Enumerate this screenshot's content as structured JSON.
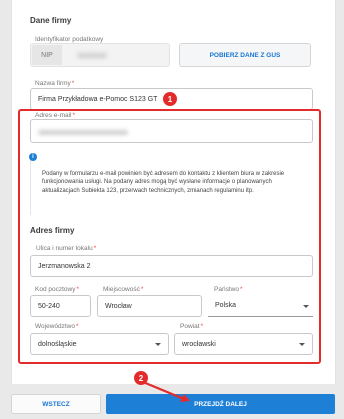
{
  "company": {
    "section_title": "Dane firmy",
    "tax_id_label": "Identyfikator podatkowy",
    "tax_id_prefix": "NIP",
    "fetch_gus_button": "POBIERZ DANE Z GUS",
    "name_label": "Nazwa firmy",
    "name_value": "Firma Przykładowa e-Pomoc S123 GT",
    "email_label": "Adres e-mail"
  },
  "info": {
    "icon_glyph": "i",
    "text": "Podany w formularzu e-mail powinien być adresem do kontaktu z klientem biura w zakresie funkcjonowania usługi. Na podany adres mogą być wysłane informacje o planowanych aktualizacjach Subiekta 123, przerwach technicznych, zmianach regulaminu itp."
  },
  "address": {
    "section_title": "Adres firmy",
    "street_label": "Ulica i numer lokalu",
    "street_value": "Jerzmanowska 2",
    "postal_label": "Kod pocztowy",
    "postal_value": "50-240",
    "city_label": "Miejscowość",
    "city_value": "Wrocław",
    "country_label": "Państwo",
    "country_value": "Polska",
    "province_label": "Województwo",
    "province_value": "dolnośląskie",
    "county_label": "Powiat",
    "county_value": "wrocławski"
  },
  "required_mark": "*",
  "annotations": {
    "badge1": "1",
    "badge2": "2",
    "accent_color": "#e32b2b"
  },
  "footer": {
    "back_button": "WSTECZ",
    "next_button": "PRZEJDŹ DALEJ"
  },
  "colors": {
    "primary": "#1e7fd6",
    "annotation_red": "#e32b2b"
  }
}
